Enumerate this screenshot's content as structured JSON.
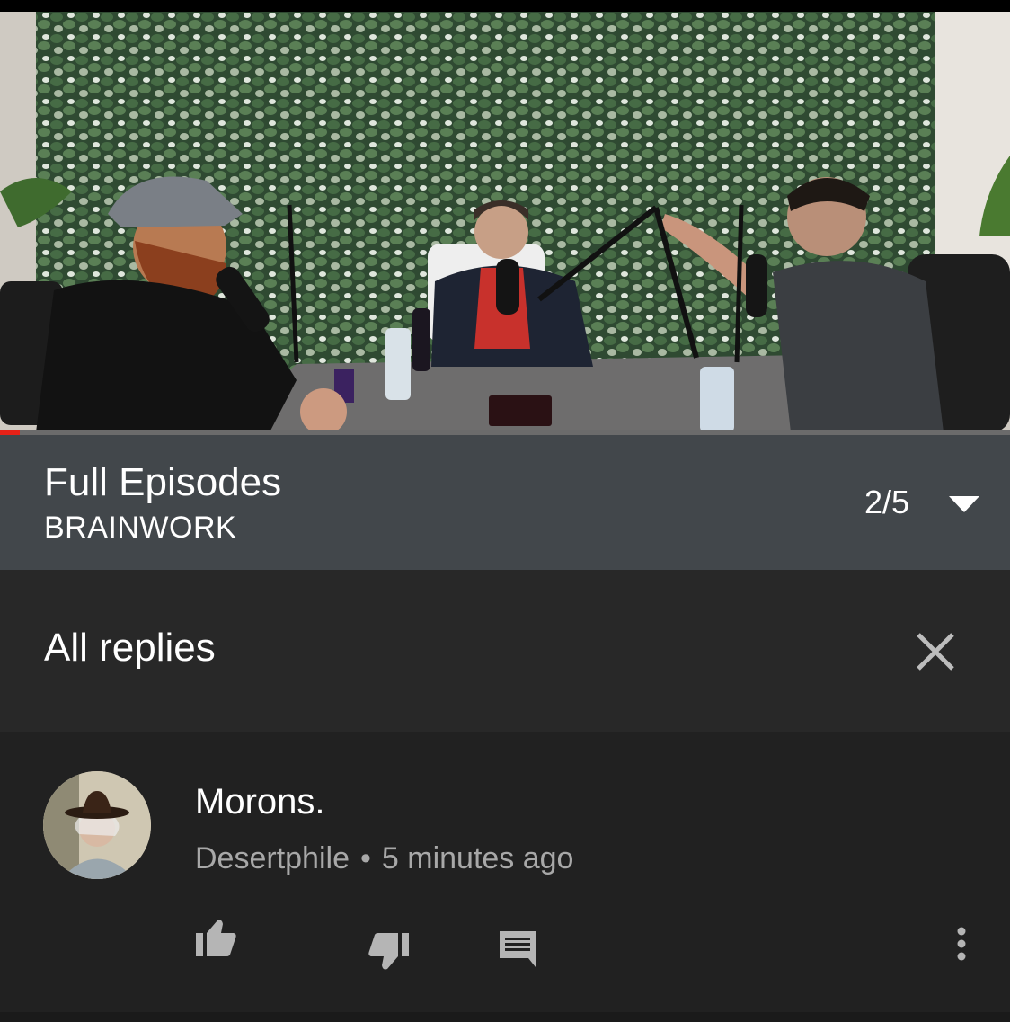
{
  "video": {
    "progress": 0.02,
    "colors": {
      "progress": "#e62117",
      "track": "#6b6b6b"
    }
  },
  "playlist": {
    "title": "Full Episodes",
    "channel": "BRAINWORK",
    "position": "2/5",
    "expand_icon": "chevron-down-icon"
  },
  "replies": {
    "title": "All replies",
    "close_icon": "close-icon"
  },
  "comment": {
    "text": "Morons.",
    "author": "Desertphile",
    "separator": "•",
    "time": "5 minutes ago",
    "actions": [
      "like-icon",
      "dislike-icon",
      "reply-icon",
      "more-vertical-icon"
    ]
  },
  "colors": {
    "background": "#212121",
    "playlist_bar": "#42474b",
    "header_bar": "#282828",
    "secondary_text": "#a8a8a8"
  }
}
